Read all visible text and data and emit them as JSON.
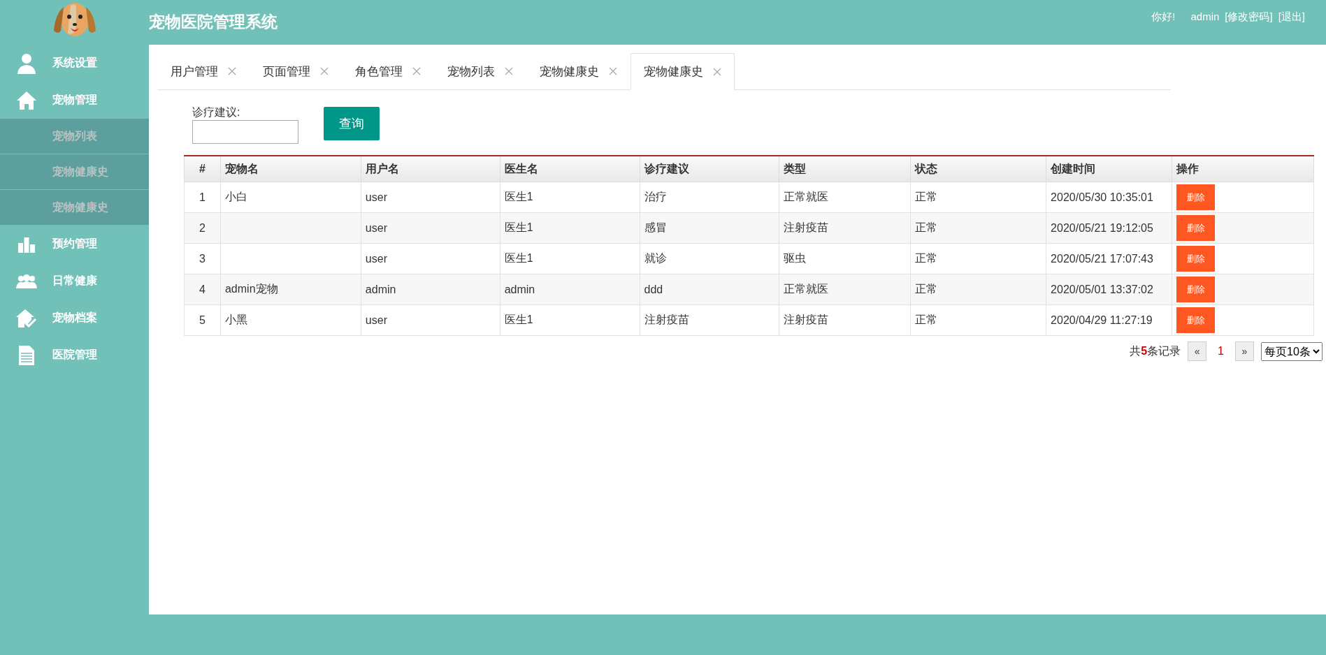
{
  "header": {
    "title": "宠物医院管理系统",
    "greeting": "你好!",
    "user": "admin",
    "links": [
      "[修改密码]",
      "[退出]"
    ]
  },
  "sidebar": {
    "items": [
      {
        "label": "系统设置"
      },
      {
        "label": "宠物管理",
        "children": [
          {
            "label": "宠物列表"
          },
          {
            "label": "宠物健康史"
          },
          {
            "label": "宠物健康史"
          }
        ]
      },
      {
        "label": "预约管理"
      },
      {
        "label": "日常健康"
      },
      {
        "label": "宠物档案"
      },
      {
        "label": "医院管理"
      }
    ]
  },
  "tabs": [
    {
      "label": "用户管理",
      "selected": false
    },
    {
      "label": "页面管理",
      "selected": false
    },
    {
      "label": "角色管理",
      "selected": false
    },
    {
      "label": "宠物列表",
      "selected": false
    },
    {
      "label": "宠物健康史",
      "selected": false
    },
    {
      "label": "宠物健康史",
      "selected": true
    }
  ],
  "search": {
    "label": "诊疗建议:",
    "button": "查询"
  },
  "table": {
    "columns": [
      "#",
      "宠物名",
      "用户名",
      "医生名",
      "诊疗建议",
      "类型",
      "状态",
      "创建时间",
      "操作"
    ],
    "rows": [
      {
        "cells": [
          "1",
          "小白",
          "user",
          "医生1",
          "治疗",
          "正常就医",
          "正常",
          "2020/05/30 10:35:01"
        ],
        "action": "删除"
      },
      {
        "cells": [
          "2",
          "",
          "user",
          "医生1",
          "感冒",
          "注射疫苗",
          "正常",
          "2020/05/21 19:12:05"
        ],
        "action": "删除"
      },
      {
        "cells": [
          "3",
          "",
          "user",
          "医生1",
          "就诊",
          "驱虫",
          "正常",
          "2020/05/21 17:07:43"
        ],
        "action": "删除"
      },
      {
        "cells": [
          "4",
          "admin宠物",
          "admin",
          "admin",
          "ddd",
          "正常就医",
          "正常",
          "2020/05/01 13:37:02"
        ],
        "action": "删除"
      },
      {
        "cells": [
          "5",
          "小黑",
          "user",
          "医生1",
          "注射疫苗",
          "注射疫苗",
          "正常",
          "2020/04/29 11:27:19"
        ],
        "action": "删除"
      }
    ]
  },
  "pagination": {
    "summary": "共**5**条记录",
    "prev": "«",
    "page": "1",
    "next": "»",
    "page_size": "每页10条"
  }
}
